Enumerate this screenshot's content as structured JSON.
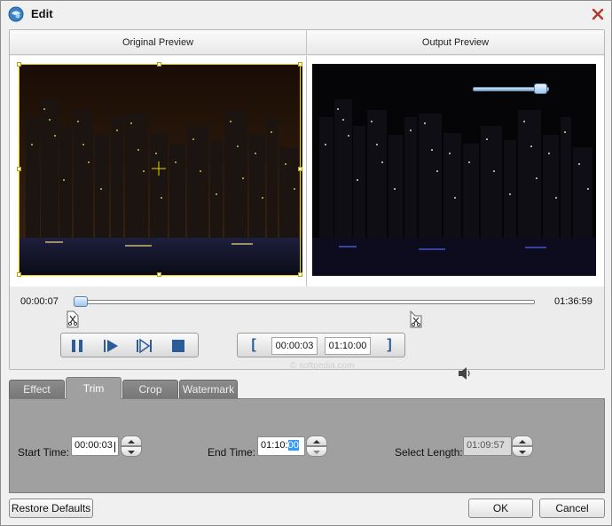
{
  "window": {
    "title": "Edit"
  },
  "preview": {
    "original_label": "Original Preview",
    "output_label": "Output Preview"
  },
  "timeline": {
    "current_time": "00:00:07",
    "total_time": "01:36:59",
    "position": 0.001
  },
  "trim_controls": {
    "start_time": "00:00:03",
    "end_time": "01:10:00"
  },
  "volume": {
    "level": 0.88
  },
  "watermark_text": "© softpedia.com",
  "tabs": [
    {
      "label": "Effect"
    },
    {
      "label": "Trim"
    },
    {
      "label": "Crop"
    },
    {
      "label": "Watermark"
    }
  ],
  "active_tab": "Trim",
  "trim_panel": {
    "start_label": "Start Time:",
    "start_value": "00:00:03",
    "end_label": "End Time:",
    "end_value_main": "01:10:",
    "end_value_selected": "00",
    "length_label": "Select Length:",
    "length_value": "01:09:57"
  },
  "buttons": {
    "restore": "Restore Defaults",
    "ok": "OK",
    "cancel": "Cancel"
  },
  "colors": {
    "accent": "#2b5c9a",
    "crop_frame": "#e6d200",
    "tab_panel": "#a0a0a0",
    "selection": "#3399ff"
  }
}
